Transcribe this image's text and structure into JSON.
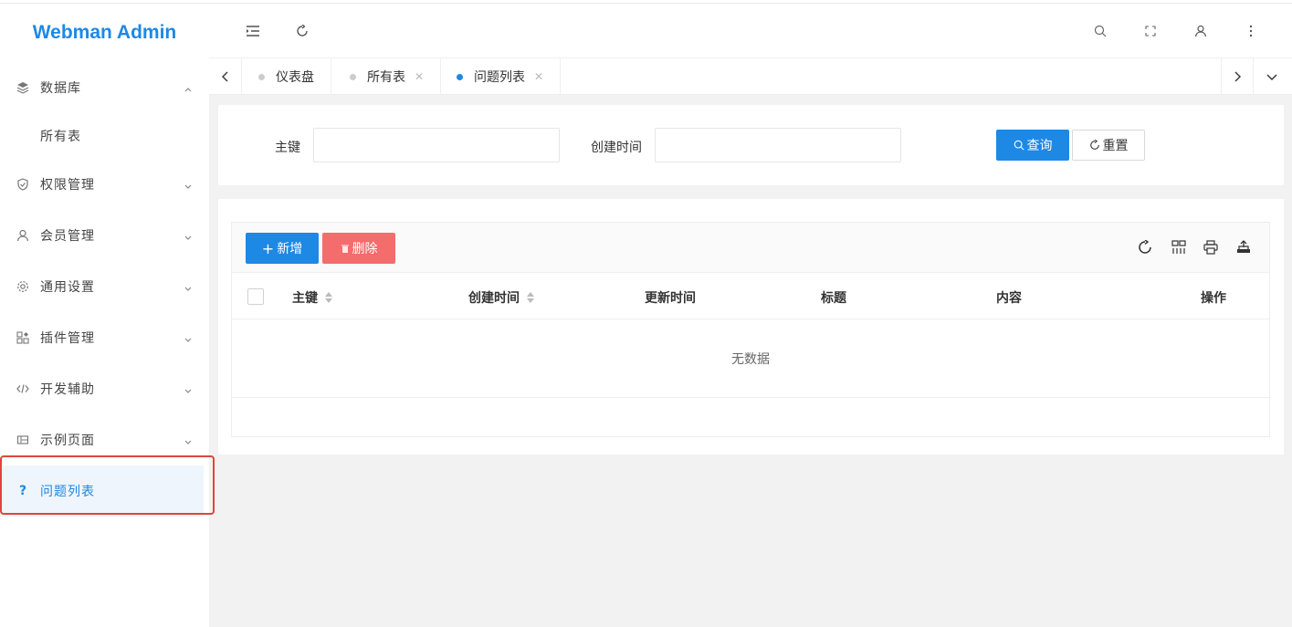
{
  "app": {
    "logo": "Webman Admin"
  },
  "sidebar": {
    "items": [
      {
        "label": "数据库",
        "icon": "layers-icon",
        "expanded": true
      },
      {
        "label": "所有表"
      },
      {
        "label": "权限管理",
        "icon": "shield-icon"
      },
      {
        "label": "会员管理",
        "icon": "user-icon"
      },
      {
        "label": "通用设置",
        "icon": "gear-icon"
      },
      {
        "label": "插件管理",
        "icon": "apps-icon"
      },
      {
        "label": "开发辅助",
        "icon": "code-icon"
      },
      {
        "label": "示例页面",
        "icon": "template-icon"
      },
      {
        "label": "问题列表",
        "icon": "question-icon",
        "active": true
      }
    ]
  },
  "header": {
    "icons": [
      "menu-fold-icon",
      "refresh-icon",
      "search-icon",
      "fullscreen-icon",
      "user-icon",
      "more-icon"
    ]
  },
  "tabs": [
    {
      "label": "仪表盘",
      "closable": false
    },
    {
      "label": "所有表",
      "closable": true
    },
    {
      "label": "问题列表",
      "closable": true,
      "active": true
    }
  ],
  "search": {
    "field1_label": "主键",
    "field1_value": "",
    "field2_label": "创建时间",
    "field2_value": "",
    "query_label": "查询",
    "reset_label": "重置"
  },
  "table": {
    "add_label": "新增",
    "delete_label": "删除",
    "columns": [
      {
        "label": "主键",
        "sortable": true
      },
      {
        "label": "创建时间",
        "sortable": true
      },
      {
        "label": "更新时间"
      },
      {
        "label": "标题"
      },
      {
        "label": "内容"
      },
      {
        "label": "操作"
      }
    ],
    "empty_text": "无数据"
  },
  "colors": {
    "primary": "#1e88e5",
    "danger": "#f56c6c",
    "highlight": "#e0443b"
  }
}
